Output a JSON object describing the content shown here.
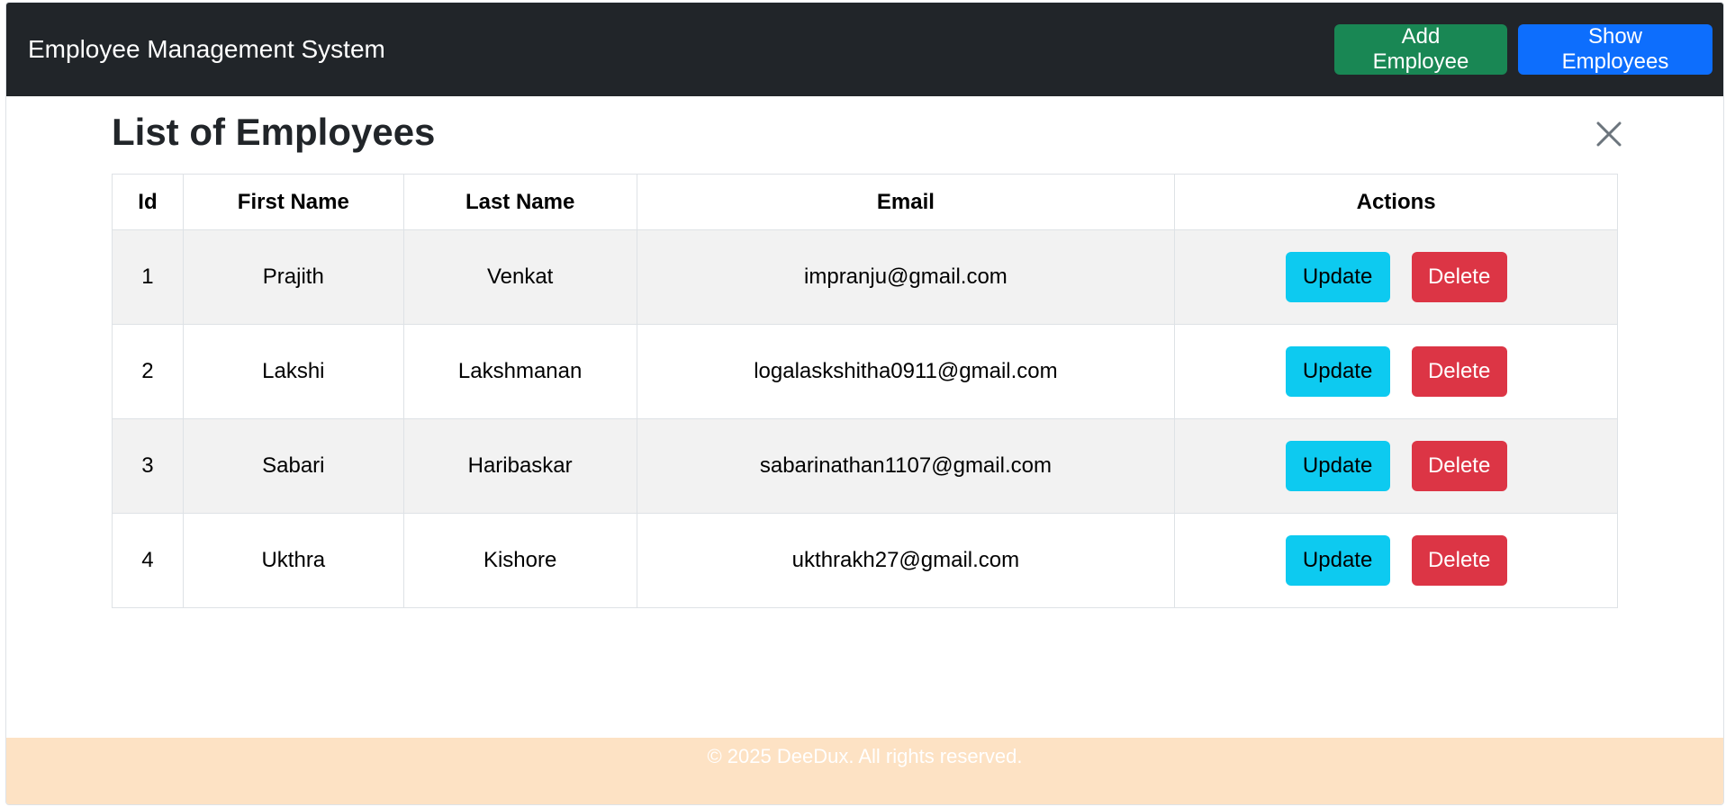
{
  "navbar": {
    "brand": "Employee Management System",
    "add_button": "Add Employee",
    "show_button": "Show Employees"
  },
  "main": {
    "title": "List of Employees",
    "close_icon": "close-icon",
    "table": {
      "headers": [
        "Id",
        "First Name",
        "Last Name",
        "Email",
        "Actions"
      ],
      "rows": [
        {
          "id": "1",
          "first": "Prajith",
          "last": "Venkat",
          "email": "impranju@gmail.com",
          "update": "Update",
          "delete": "Delete"
        },
        {
          "id": "2",
          "first": "Lakshi",
          "last": "Lakshmanan",
          "email": "logalaskshitha0911@gmail.com",
          "update": "Update",
          "delete": "Delete"
        },
        {
          "id": "3",
          "first": "Sabari",
          "last": "Haribaskar",
          "email": "sabarinathan1107@gmail.com",
          "update": "Update",
          "delete": "Delete"
        },
        {
          "id": "4",
          "first": "Ukthra",
          "last": "Kishore",
          "email": "ukthrakh27@gmail.com",
          "update": "Update",
          "delete": "Delete"
        }
      ]
    }
  },
  "footer": {
    "text": "© 2025 DeeDux. All rights reserved."
  },
  "colors": {
    "navbar_bg": "#212529",
    "success": "#198754",
    "primary": "#0d6efd",
    "info": "#0dcaf0",
    "danger": "#dc3545",
    "footer_bg": "#fde2c4"
  }
}
